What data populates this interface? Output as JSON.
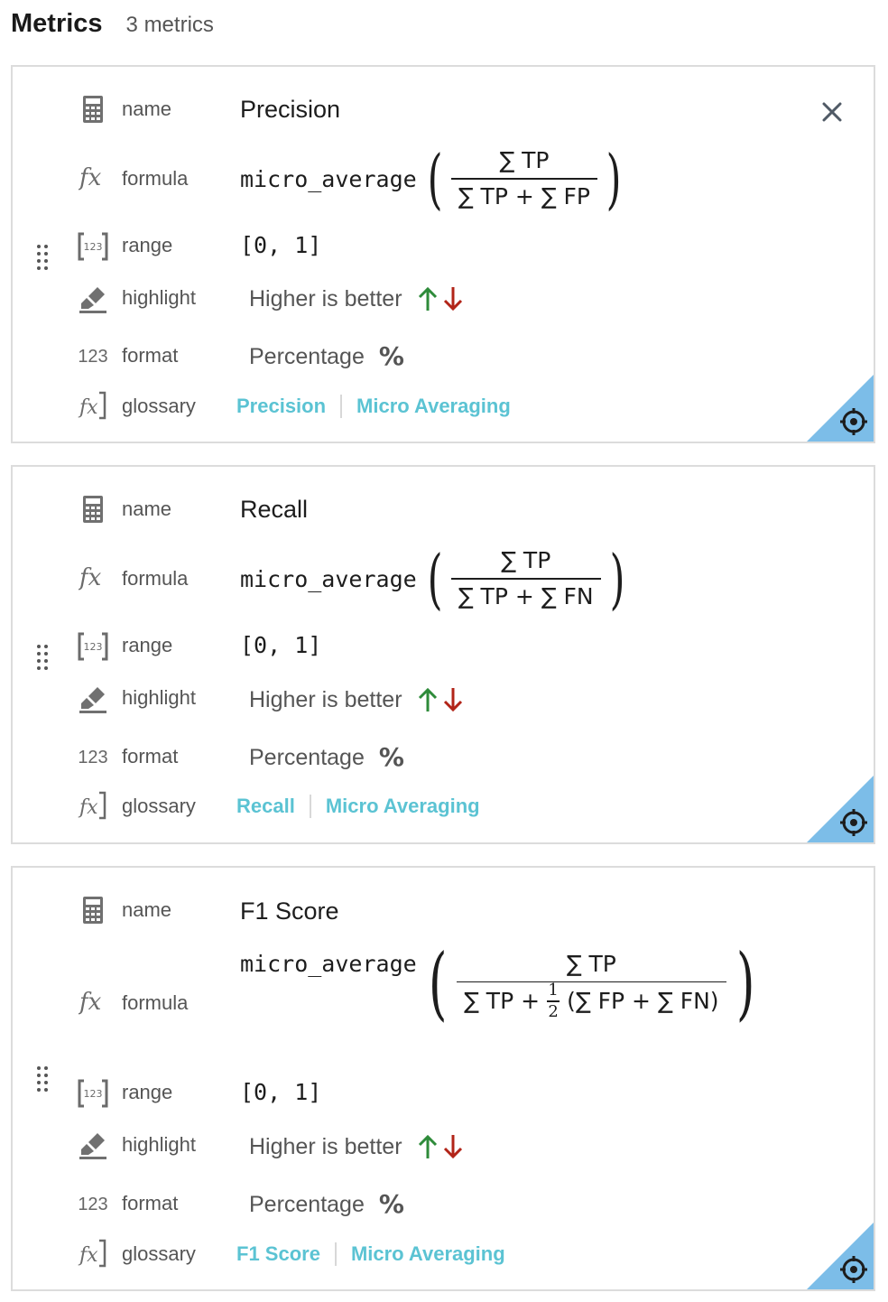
{
  "header": {
    "title": "Metrics",
    "count": "3 metrics"
  },
  "labels": {
    "name": "name",
    "formula": "formula",
    "range": "range",
    "highlight": "highlight",
    "format": "format",
    "glossary": "glossary",
    "format_icon": "123"
  },
  "colors": {
    "link": "#5bc3d3",
    "up_arrow": "#2e8b3a",
    "down_arrow": "#b22418",
    "corner": "#7cbde8"
  },
  "icons": [
    "calculator-icon",
    "function-icon",
    "range-icon",
    "highlighter-icon",
    "function-doc-icon",
    "drag-handle-icon",
    "close-icon",
    "target-icon",
    "arrow-up-icon",
    "arrow-down-icon",
    "percent-icon"
  ],
  "metrics": [
    {
      "name": "Precision",
      "formula": {
        "fn": "micro_average",
        "numerator": "∑ TP",
        "denominator": "∑ TP + ∑ FP"
      },
      "range": "[0, 1]",
      "highlight": "Higher is better",
      "format": "Percentage",
      "format_symbol": "%",
      "glossary": [
        "Precision",
        "Micro Averaging"
      ]
    },
    {
      "name": "Recall",
      "formula": {
        "fn": "micro_average",
        "numerator": "∑ TP",
        "denominator": "∑ TP + ∑ FN"
      },
      "range": "[0, 1]",
      "highlight": "Higher is better",
      "format": "Percentage",
      "format_symbol": "%",
      "glossary": [
        "Recall",
        "Micro Averaging"
      ]
    },
    {
      "name": "F1 Score",
      "formula": {
        "fn": "micro_average",
        "numerator": "∑ TP",
        "denominator_pre": "∑ TP +",
        "half_num": "1",
        "half_den": "2",
        "denominator_post": "(∑ FP + ∑ FN)"
      },
      "range": "[0, 1]",
      "highlight": "Higher is better",
      "format": "Percentage",
      "format_symbol": "%",
      "glossary": [
        "F1 Score",
        "Micro Averaging"
      ]
    }
  ]
}
